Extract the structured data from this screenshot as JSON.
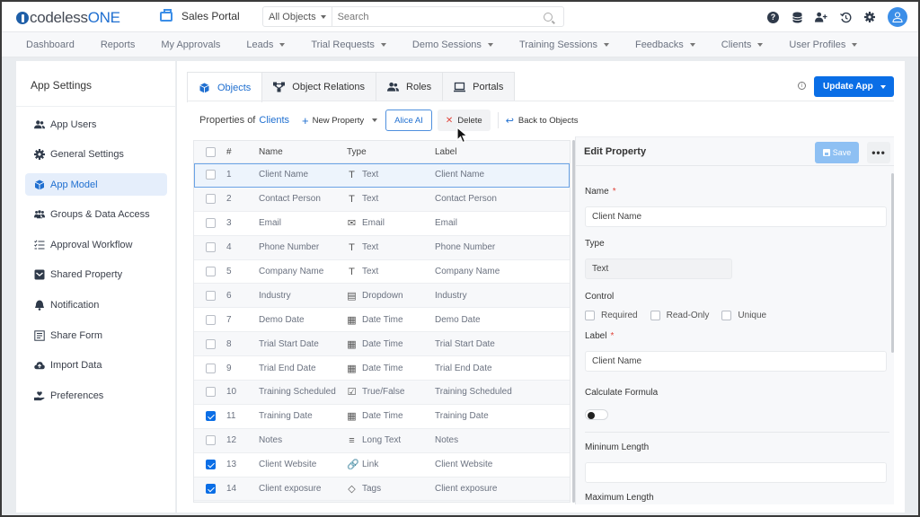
{
  "brand": {
    "logo_prefix": "codeless",
    "logo_suffix": "ONE",
    "accent": "#0a6ee6"
  },
  "app": {
    "name": "Sales Portal",
    "icon": "toolbox-icon"
  },
  "search": {
    "scope": "All Objects",
    "placeholder": "Search",
    "value": ""
  },
  "top_icons": [
    "help-icon",
    "database-icon",
    "add-user-icon",
    "history-icon",
    "gear-icon",
    "avatar"
  ],
  "nav": [
    {
      "label": "Dashboard",
      "dropdown": false
    },
    {
      "label": "Reports",
      "dropdown": false
    },
    {
      "label": "My Approvals",
      "dropdown": false
    },
    {
      "label": "Leads",
      "dropdown": true
    },
    {
      "label": "Trial Requests",
      "dropdown": true
    },
    {
      "label": "Demo Sessions",
      "dropdown": true
    },
    {
      "label": "Training Sessions",
      "dropdown": true
    },
    {
      "label": "Feedbacks",
      "dropdown": true
    },
    {
      "label": "Clients",
      "dropdown": true
    },
    {
      "label": "User Profiles",
      "dropdown": true
    }
  ],
  "sidebar": {
    "title": "App Settings",
    "items": [
      {
        "label": "App Users",
        "icon": "users-icon",
        "active": false
      },
      {
        "label": "General Settings",
        "icon": "gear-icon",
        "active": false
      },
      {
        "label": "App Model",
        "icon": "cube-icon",
        "active": true
      },
      {
        "label": "Groups & Data Access",
        "icon": "groups-icon",
        "active": false
      },
      {
        "label": "Approval Workflow",
        "icon": "checklist-icon",
        "active": false
      },
      {
        "label": "Shared Property",
        "icon": "inbox-icon",
        "active": false
      },
      {
        "label": "Notification",
        "icon": "bell-icon",
        "active": false
      },
      {
        "label": "Share Form",
        "icon": "form-icon",
        "active": false
      },
      {
        "label": "Import Data",
        "icon": "cloud-upload-icon",
        "active": false
      },
      {
        "label": "Preferences",
        "icon": "hand-heart-icon",
        "active": false
      }
    ]
  },
  "tabs": [
    {
      "label": "Objects",
      "icon": "cube-icon",
      "active": true
    },
    {
      "label": "Object Relations",
      "icon": "relations-icon",
      "active": false
    },
    {
      "label": "Roles",
      "icon": "users-icon",
      "active": false
    },
    {
      "label": "Portals",
      "icon": "laptop-icon",
      "active": false
    }
  ],
  "update_button": "Update App",
  "actions": {
    "properties_of": "Properties of",
    "object_name": "Clients",
    "new_property": "New Property",
    "alice_ai": "Alice AI",
    "delete": "Delete",
    "back": "Back to Objects"
  },
  "table": {
    "headers": {
      "num": "#",
      "name": "Name",
      "type": "Type",
      "label": "Label"
    },
    "rows": [
      {
        "num": "1",
        "name": "Client Name",
        "type": "Text",
        "type_icon": "T",
        "label": "Client Name",
        "checked": false,
        "selected": true
      },
      {
        "num": "2",
        "name": "Contact Person",
        "type": "Text",
        "type_icon": "T",
        "label": "Contact Person",
        "checked": false
      },
      {
        "num": "3",
        "name": "Email",
        "type": "Email",
        "type_icon": "✉",
        "label": "Email",
        "checked": false
      },
      {
        "num": "4",
        "name": "Phone Number",
        "type": "Text",
        "type_icon": "T",
        "label": "Phone Number",
        "checked": false
      },
      {
        "num": "5",
        "name": "Company Name",
        "type": "Text",
        "type_icon": "T",
        "label": "Company Name",
        "checked": false
      },
      {
        "num": "6",
        "name": "Industry",
        "type": "Dropdown",
        "type_icon": "▤",
        "label": "Industry",
        "checked": false
      },
      {
        "num": "7",
        "name": "Demo Date",
        "type": "Date Time",
        "type_icon": "▦",
        "label": "Demo Date",
        "checked": false
      },
      {
        "num": "8",
        "name": "Trial Start Date",
        "type": "Date Time",
        "type_icon": "▦",
        "label": "Trial Start Date",
        "checked": false
      },
      {
        "num": "9",
        "name": "Trial End Date",
        "type": "Date Time",
        "type_icon": "▦",
        "label": "Trial End Date",
        "checked": false
      },
      {
        "num": "10",
        "name": "Training Scheduled",
        "type": "True/False",
        "type_icon": "☑",
        "label": "Training Scheduled",
        "checked": false
      },
      {
        "num": "11",
        "name": "Training Date",
        "type": "Date Time",
        "type_icon": "▦",
        "label": "Training Date",
        "checked": true
      },
      {
        "num": "12",
        "name": "Notes",
        "type": "Long Text",
        "type_icon": "≡",
        "label": "Notes",
        "checked": false
      },
      {
        "num": "13",
        "name": "Client Website",
        "type": "Link",
        "type_icon": "🔗",
        "label": "Client Website",
        "checked": true
      },
      {
        "num": "14",
        "name": "Client exposure",
        "type": "Tags",
        "type_icon": "◇",
        "label": "Client exposure",
        "checked": true
      }
    ]
  },
  "edit": {
    "title": "Edit Property",
    "save": "Save",
    "more": "•••",
    "name_label": "Name",
    "name_value": "Client Name",
    "type_label": "Type",
    "type_value": "Text",
    "control_label": "Control",
    "controls": [
      {
        "label": "Required",
        "checked": false
      },
      {
        "label": "Read-Only",
        "checked": false
      },
      {
        "label": "Unique",
        "checked": false
      }
    ],
    "label_label": "Label",
    "label_value": "Client Name",
    "formula_label": "Calculate Formula",
    "formula_on": false,
    "min_label": "Mininum Length",
    "min_value": "",
    "max_label": "Maximum Length"
  }
}
